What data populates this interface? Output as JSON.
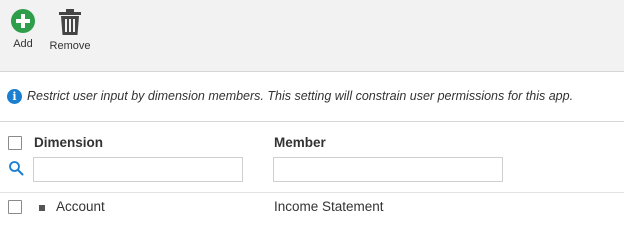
{
  "toolbar": {
    "add_label": "Add",
    "remove_label": "Remove",
    "add_icon": "add-circle-icon",
    "remove_icon": "trash-icon",
    "add_color": "#2e9e4b",
    "remove_color": "#444444"
  },
  "info": {
    "icon": "info-icon",
    "text": "Restrict user input by dimension members. This setting will constrain user permissions for this app."
  },
  "grid": {
    "columns": [
      {
        "label": "Dimension"
      },
      {
        "label": "Member"
      }
    ],
    "filters": {
      "dimension_value": "",
      "member_value": ""
    },
    "rows": [
      {
        "dimension": "Account",
        "member": "Income Statement",
        "checked": false
      }
    ]
  }
}
